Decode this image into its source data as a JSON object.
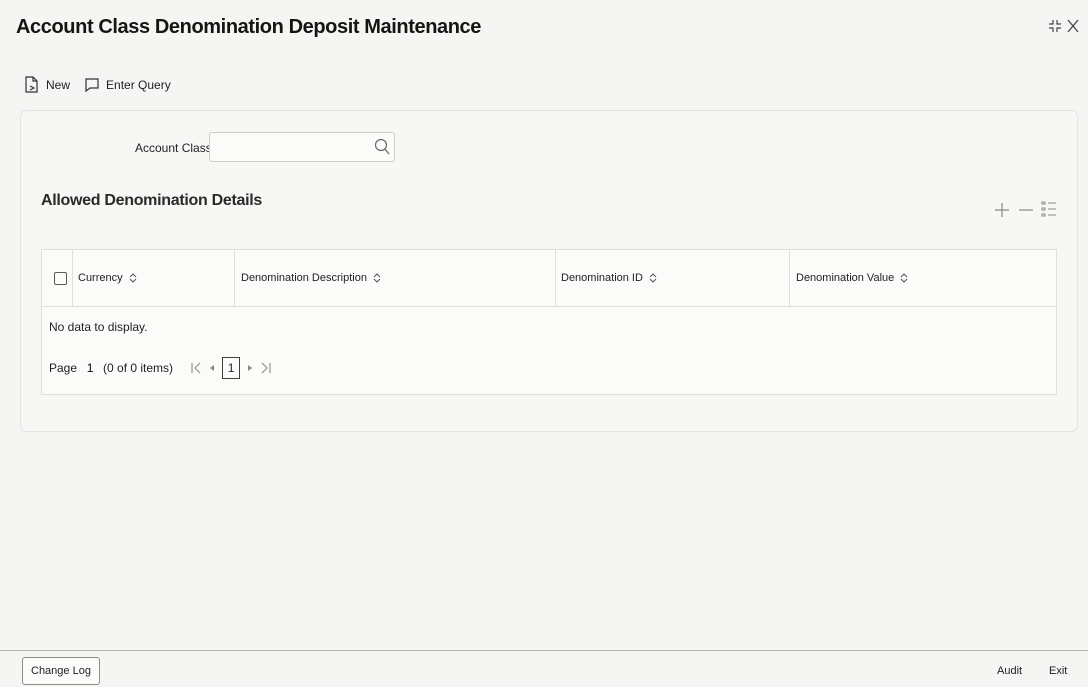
{
  "window": {
    "title": "Account Class Denomination Deposit Maintenance"
  },
  "toolbar": {
    "new_label": "New",
    "enter_query_label": "Enter Query"
  },
  "form": {
    "account_class_label": "Account Class",
    "account_class_value": ""
  },
  "section": {
    "title": "Allowed Denomination Details"
  },
  "grid": {
    "columns": [
      "Currency",
      "Denomination Description",
      "Denomination ID",
      "Denomination Value"
    ],
    "empty_message": "No data to display.",
    "rows": []
  },
  "pagination": {
    "page_label": "Page",
    "page_input": "1",
    "items_text": "(0 of 0 items)",
    "current_page": "1"
  },
  "footer": {
    "change_log_label": "Change Log",
    "audit_label": "Audit",
    "exit_label": "Exit"
  }
}
